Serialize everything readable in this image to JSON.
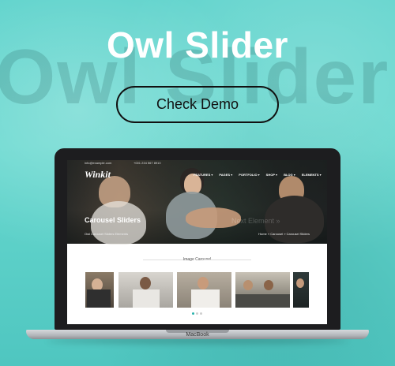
{
  "banner": {
    "title": "Owl Slider",
    "background_word": "Owl Slider",
    "button_label": "Check Demo",
    "accent": "#5fd3cc"
  },
  "laptop": {
    "brand": "MacBook"
  },
  "site": {
    "topbar_email": "info@example.com",
    "topbar_phone": "+001 234 567 8910",
    "logo": "Winkit",
    "nav": [
      "FEATURES ▾",
      "PAGES ▾",
      "PORTFOLIO ▾",
      "SHOP ▾",
      "BLOG ▾",
      "ELEMENTS ▾"
    ],
    "page_title": "Carousel Sliders",
    "crumb_left": "Owl Carousel Sliders Elements",
    "crumb_right": "Home » Carousel » Carousel Sliders",
    "ghost_text": "Next Element »",
    "section_label": "Image Carousel",
    "accent": "#2bb3ad"
  },
  "carousel": {
    "slide_count": 5,
    "dot_count": 3,
    "active_dot": 0
  }
}
